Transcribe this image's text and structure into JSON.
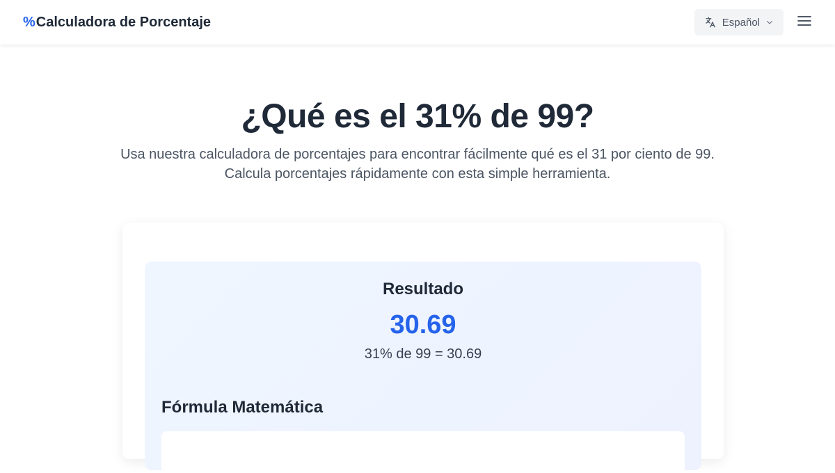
{
  "header": {
    "brand_symbol": "%",
    "brand_name": "Calculadora de Porcentaje",
    "language_label": "Español",
    "icons": {
      "language": "translate-icon",
      "dropdown": "chevron-down-icon",
      "menu": "hamburger-menu-icon"
    }
  },
  "hero": {
    "title": "¿Qué es el 31% de 99?",
    "subtitle": "Usa nuestra calculadora de porcentajes para encontrar fácilmente qué es el 31 por ciento de 99. Calcula porcentajes rápidamente con esta simple herramienta."
  },
  "result": {
    "title": "Resultado",
    "value": "30.69",
    "equation": "31% de 99 = 30.69"
  },
  "formula": {
    "title": "Fórmula Matemática"
  },
  "colors": {
    "accent": "#2563eb",
    "text": "#1f2937",
    "muted": "#4b5563",
    "result_bg_start": "#eff6ff",
    "result_bg_end": "#eef2ff"
  }
}
